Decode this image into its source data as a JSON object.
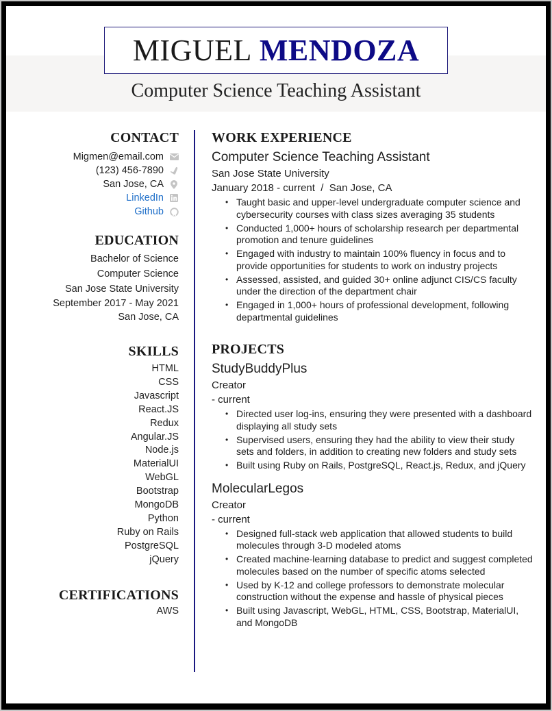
{
  "header": {
    "first_name": "MIGUEL",
    "last_name": "MENDOZA",
    "title": "Computer Science Teaching Assistant"
  },
  "colors": {
    "accent_navy": "#0d0a86",
    "divider": "#1a1780",
    "link": "#1f6fc9",
    "band": "#f6f5f4",
    "icon_gray": "#c4c4c4"
  },
  "contact": {
    "heading": "CONTACT",
    "items": [
      {
        "text": "Migmen@email.com",
        "icon": "envelope-icon"
      },
      {
        "text": "(123) 456-7890",
        "icon": "phone-icon"
      },
      {
        "text": "San Jose, CA",
        "icon": "location-pin-icon"
      },
      {
        "text": "LinkedIn",
        "icon": "linkedin-icon",
        "link": true
      },
      {
        "text": "Github",
        "icon": "github-icon",
        "link": true
      }
    ]
  },
  "education": {
    "heading": "EDUCATION",
    "degree": "Bachelor of Science",
    "major": "Computer Science",
    "school": "San Jose State University",
    "dates": "September 2017 - May 2021",
    "location": "San Jose, CA"
  },
  "skills": {
    "heading": "SKILLS",
    "items": [
      "HTML",
      "CSS",
      "Javascript",
      "React.JS",
      "Redux",
      "Angular.JS",
      "Node.js",
      "MaterialUI",
      "WebGL",
      "Bootstrap",
      "MongoDB",
      "Python",
      "Ruby on Rails",
      "PostgreSQL",
      "jQuery"
    ]
  },
  "certifications": {
    "heading": "CERTIFICATIONS",
    "items": [
      "AWS"
    ]
  },
  "experience": {
    "heading": "WORK EXPERIENCE",
    "jobs": [
      {
        "title": "Computer Science Teaching Assistant",
        "company": "San Jose State University",
        "dates_location": "January 2018 - current  /  San Jose, CA",
        "bullets": [
          "Taught basic and upper-level undergraduate computer science and cybersecurity courses with class sizes averaging 35 students",
          "Conducted 1,000+ hours of scholarship research per departmental promotion and tenure guidelines",
          "Engaged with industry to maintain 100% fluency in focus and to provide opportunities for students to work on industry projects",
          "Assessed, assisted, and guided 30+ online adjunct CIS/CS faculty under the direction of the department chair",
          "Engaged in 1,000+ hours of professional development, following departmental guidelines"
        ]
      }
    ]
  },
  "projects": {
    "heading": "PROJECTS",
    "items": [
      {
        "name": "StudyBuddyPlus",
        "role": "Creator",
        "dates": "- current",
        "bullets": [
          "Directed user log-ins, ensuring they were presented with a dashboard displaying all study sets",
          "Supervised users, ensuring they had the ability to view their study sets and folders, in addition to creating new folders and study sets",
          "Built using Ruby on Rails, PostgreSQL, React.js, Redux, and jQuery"
        ]
      },
      {
        "name": "MolecularLegos",
        "role": "Creator",
        "dates": "- current",
        "bullets": [
          "Designed full-stack web application that allowed students to build molecules through 3-D modeled atoms",
          "Created machine-learning database to predict and suggest completed molecules based on the number of specific atoms selected",
          "Used by K-12 and college professors to demonstrate molecular construction without the expense and hassle of physical pieces",
          "Built using Javascript, WebGL, HTML, CSS, Bootstrap, MaterialUI, and MongoDB"
        ]
      }
    ]
  }
}
